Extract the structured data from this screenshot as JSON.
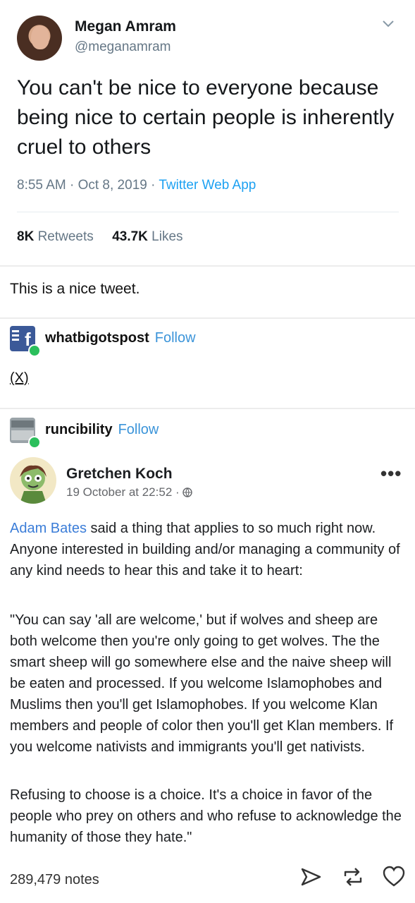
{
  "tweet": {
    "name": "Megan Amram",
    "handle": "@meganamram",
    "text": "You can't be nice to everyone because being nice to certain people is inherently cruel to others",
    "time": "8:55 AM · Oct 8, 2019 · ",
    "source": "Twitter Web App",
    "retweets_count": "8K",
    "retweets_label": " Retweets",
    "likes_count": "43.7K",
    "likes_label": " Likes"
  },
  "comment": "This is a nice tweet.",
  "reblog1": {
    "blog": "whatbigotspost",
    "follow": "Follow",
    "text": "(X)"
  },
  "reblog2": {
    "blog": "runcibility",
    "follow": "Follow"
  },
  "fb_post": {
    "author": "Gretchen Koch",
    "date": "19 October at 22:52 · ",
    "menu": "•••",
    "link": "Adam Bates",
    "p1_rest": " said a thing that applies to so much right now. Anyone interested in building and/or managing a community of any kind needs to hear this and take it to heart:",
    "p2": "\"You can say 'all are welcome,' but if wolves and sheep are both welcome then you're only going to get wolves. The the smart sheep will go somewhere else and the naive sheep will be eaten and processed. If you welcome Islamophobes and Muslims then you'll get Islamophobes. If you welcome Klan members and people of color then you'll get Klan members. If you welcome nativists and immigrants you'll get nativists.",
    "p3": "Refusing to choose is a choice. It's a choice in favor of the people who prey on others and who refuse to acknowledge the humanity of those they hate.\""
  },
  "footer": {
    "notes": "289,479 notes"
  },
  "icons": {
    "chevron": "chevron-down-icon",
    "globe": "globe-icon",
    "share": "share-icon",
    "reblog": "reblog-icon",
    "like": "heart-icon"
  },
  "colors": {
    "twitter_blue": "#1da1f2",
    "tumblr_follow": "#3b94d9",
    "fb_link": "#3b7dd8"
  }
}
